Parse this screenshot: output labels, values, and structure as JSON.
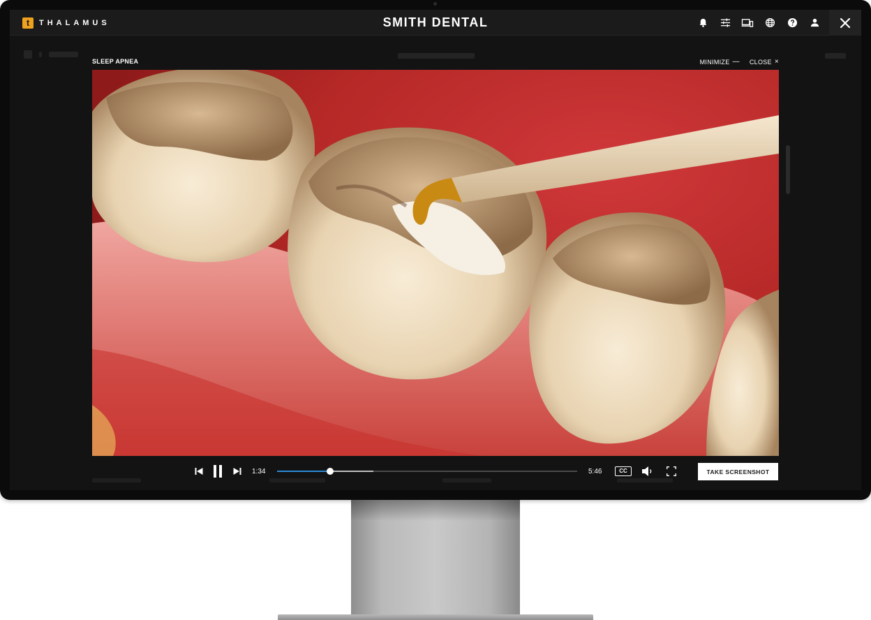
{
  "app": {
    "brand_letter": "t",
    "brand_name": "THALAMUS",
    "practice_name": "SMITH DENTAL",
    "accent_color": "#f0a11d",
    "top_icons": [
      "bell-icon",
      "sliders-icon",
      "devices-icon",
      "globe-icon",
      "help-icon",
      "user-icon"
    ],
    "close_icon": "close-icon"
  },
  "modal": {
    "title": "SLEEP APNEA",
    "minimize_label": "MINIMIZE",
    "minimize_glyph": "—",
    "close_label": "CLOSE",
    "close_glyph": "×"
  },
  "player": {
    "current_time": "1:34",
    "duration": "5:46",
    "progress_fraction": 0.176,
    "buffered_fraction": 0.321,
    "cc_label": "CC",
    "screenshot_label": "TAKE SCREENSHOT",
    "progress_color": "#2a8bd6",
    "controls": [
      "skip-back-icon",
      "pause-icon",
      "skip-forward-icon",
      "volume-icon",
      "fullscreen-icon"
    ]
  }
}
